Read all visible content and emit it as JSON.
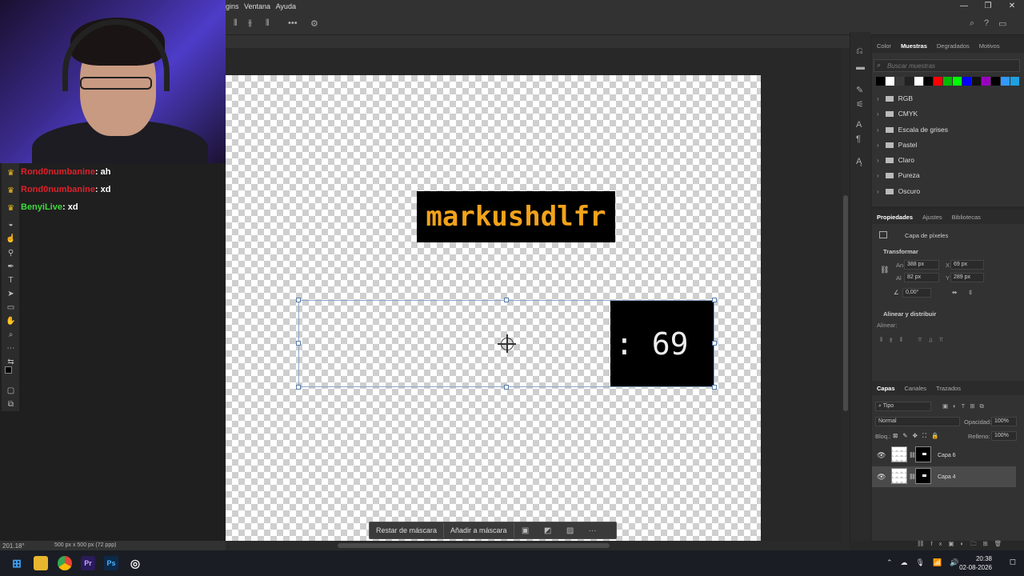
{
  "menubar": {
    "items": [
      "gins",
      "Ventana",
      "Ayuda"
    ]
  },
  "chat": {
    "lines": [
      {
        "user": "Rond0numbanine",
        "msg": "ah"
      },
      {
        "user": "Rond0numbanine",
        "msg": "xd"
      },
      {
        "user": "BenyiLive",
        "msg": "xd"
      }
    ]
  },
  "canvas": {
    "name_text": "markushdlfr",
    "num_text": ": 69"
  },
  "context_bar": {
    "subtract_mask": "Restar de máscara",
    "add_mask": "Añadir a máscara",
    "more": "···"
  },
  "status": {
    "zoom": "201.18°",
    "doc_info": "500 px x 500 px (72 ppp)"
  },
  "swatches": {
    "tabs": [
      "Color",
      "Muestras",
      "Degradados",
      "Motivos"
    ],
    "active_tab": "Muestras",
    "search_placeholder": "Buscar muestras",
    "colors": [
      "#000000",
      "#ffffff",
      "#3a3a3a",
      "#222222",
      "#ffffff",
      "#000000",
      "#ff0000",
      "#00bb00",
      "#00ff00",
      "#0000ff",
      "#111111",
      "#9b00c0",
      "#000000",
      "#3399ff",
      "#1ea0e0"
    ],
    "folders": [
      "RGB",
      "CMYK",
      "Escala de grises",
      "Pastel",
      "Claro",
      "Pureza",
      "Oscuro"
    ]
  },
  "properties": {
    "tabs": [
      "Propiedades",
      "Ajustes",
      "Bibliotecas"
    ],
    "active_tab": "Propiedades",
    "layer_type": "Capa de píxeles",
    "transform_header": "Transformar",
    "an_label": "An",
    "an_value": "388 px",
    "x_label": "X",
    "x_value": "69 px",
    "al_label": "Al",
    "al_value": "82 px",
    "y_label": "Y",
    "y_value": "289 px",
    "angle_value": "0,00°",
    "align_header": "Alinear y distribuir",
    "align_label": "Alinear:"
  },
  "layers": {
    "tabs": [
      "Capas",
      "Canales",
      "Trazados"
    ],
    "active_tab": "Capas",
    "filter": "Tipo",
    "blend_mode": "Normal",
    "opacity_label": "Opacidad:",
    "opacity_value": "100%",
    "lock_label": "Bloq.:",
    "fill_label": "Relleno:",
    "fill_value": "100%",
    "items": [
      "Capa 6",
      "Capa 4"
    ],
    "selected": "Capa 4"
  },
  "clock": {
    "time": "20:38",
    "date": "02-08-2026"
  }
}
